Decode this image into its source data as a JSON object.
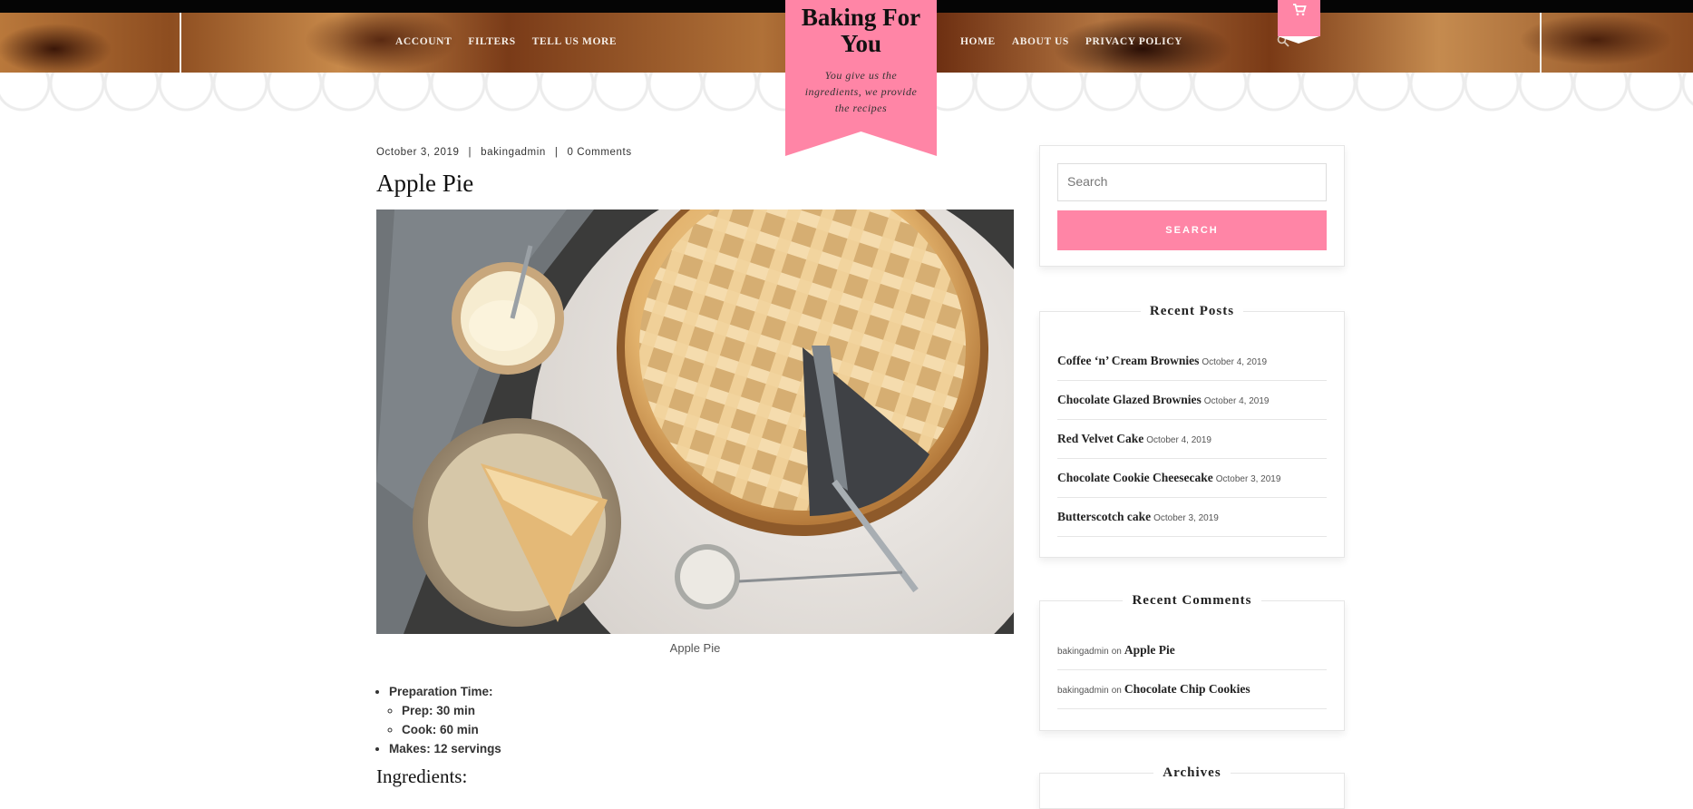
{
  "header": {
    "nav_left": [
      "ACCOUNT",
      "FILTERS",
      "TELL US MORE"
    ],
    "nav_right": [
      "HOME",
      "ABOUT US",
      "PRIVACY POLICY"
    ],
    "site_title": "Baking For You",
    "tagline": "You give us the ingredients, we provide the recipes",
    "cart_icon": "cart-icon",
    "search_icon": "search-icon"
  },
  "post": {
    "date": "October 3, 2019",
    "author": "bakingadmin",
    "comments": "0 Comments",
    "title": "Apple Pie",
    "image_caption": "Apple Pie",
    "details": {
      "prep_time_label": "Preparation Time:",
      "prep": "Prep: 30 min",
      "cook": "Cook: 60 min",
      "makes": "Makes: 12 servings"
    },
    "ingredients_heading": "Ingredients:"
  },
  "sidebar": {
    "search": {
      "placeholder": "Search",
      "button": "SEARCH"
    },
    "recent_posts": {
      "title": "Recent Posts",
      "items": [
        {
          "name": "Coffee ‘n’ Cream Brownies",
          "date": "October 4, 2019"
        },
        {
          "name": "Chocolate Glazed Brownies",
          "date": "October 4, 2019"
        },
        {
          "name": "Red Velvet Cake",
          "date": "October 4, 2019"
        },
        {
          "name": "Chocolate Cookie Cheesecake",
          "date": "October 3, 2019"
        },
        {
          "name": "Butterscotch cake",
          "date": "October 3, 2019"
        }
      ]
    },
    "recent_comments": {
      "title": "Recent Comments",
      "items": [
        {
          "author": "bakingadmin",
          "on": "on",
          "post": "Apple Pie"
        },
        {
          "author": "bakingadmin",
          "on": "on",
          "post": "Chocolate Chip Cookies"
        }
      ]
    },
    "archives": {
      "title": "Archives"
    }
  },
  "colors": {
    "accent": "#ff85a6",
    "topbar": "#050505"
  }
}
